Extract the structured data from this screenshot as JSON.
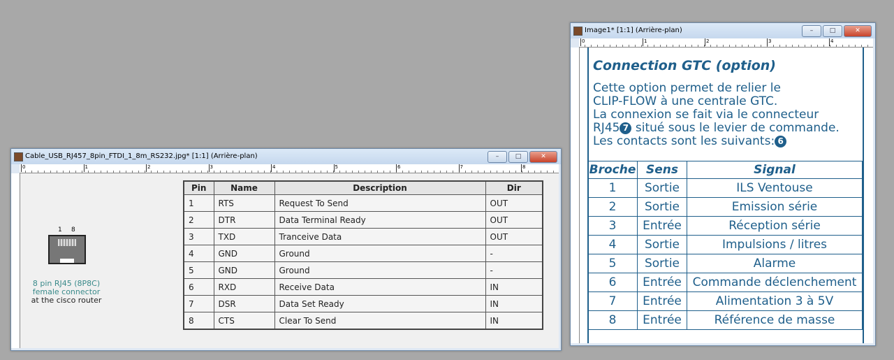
{
  "left_window": {
    "title": "Cable_USB_RJ457_8pin_FTDI_1_8m_RS232.jpg* [1:1] (Arrière-plan)",
    "ruler_labels": [
      "0",
      "1",
      "2",
      "3",
      "4",
      "5",
      "6",
      "7",
      "8"
    ],
    "connector": {
      "pins_label_left": "1",
      "pins_label_right": "8",
      "caption_line1": "8 pin RJ45 (8P8C)",
      "caption_line2": "female connector",
      "caption_line3": "at the cisco router"
    },
    "table": {
      "headers": [
        "Pin",
        "Name",
        "Description",
        "Dir"
      ],
      "rows": [
        [
          "1",
          "RTS",
          "Request To Send",
          "OUT"
        ],
        [
          "2",
          "DTR",
          "Data Terminal Ready",
          "OUT"
        ],
        [
          "3",
          "TXD",
          "Tranceive Data",
          "OUT"
        ],
        [
          "4",
          "GND",
          "Ground",
          "-"
        ],
        [
          "5",
          "GND",
          "Ground",
          "-"
        ],
        [
          "6",
          "RXD",
          "Receive Data",
          "IN"
        ],
        [
          "7",
          "DSR",
          "Data Set Ready",
          "IN"
        ],
        [
          "8",
          "CTS",
          "Clear To Send",
          "IN"
        ]
      ]
    }
  },
  "right_window": {
    "title": "Image1* [1:1] (Arrière-plan)",
    "ruler_labels": [
      "0",
      "1",
      "2",
      "3",
      "4"
    ],
    "heading": "Connection GTC (option)",
    "para_line1": "Cette option permet de relier le",
    "para_line2": "CLIP-FLOW à une centrale GTC.",
    "para_line3": "La connexion se fait via le connecteur",
    "para_line4a": "RJ45",
    "badge7": "7",
    "para_line4b": "situé sous le levier de commande.",
    "para_line5": "Les contacts sont les suivants:",
    "badge6": "6",
    "table": {
      "headers": [
        "Broche",
        "Sens",
        "Signal"
      ],
      "rows": [
        [
          "1",
          "Sortie",
          "ILS Ventouse"
        ],
        [
          "2",
          "Sortie",
          "Emission série"
        ],
        [
          "3",
          "Entrée",
          "Réception série"
        ],
        [
          "4",
          "Sortie",
          "Impulsions / litres"
        ],
        [
          "5",
          "Sortie",
          "Alarme"
        ],
        [
          "6",
          "Entrée",
          "Commande déclenchement"
        ],
        [
          "7",
          "Entrée",
          "Alimentation 3 à 5V"
        ],
        [
          "8",
          "Entrée",
          "Référence de masse"
        ]
      ]
    }
  },
  "window_controls": {
    "minimize": "–",
    "maximize": "□",
    "close": "✕"
  },
  "colors": {
    "accent": "#1f5f8b",
    "connector_caption": "#3a8a8a"
  }
}
